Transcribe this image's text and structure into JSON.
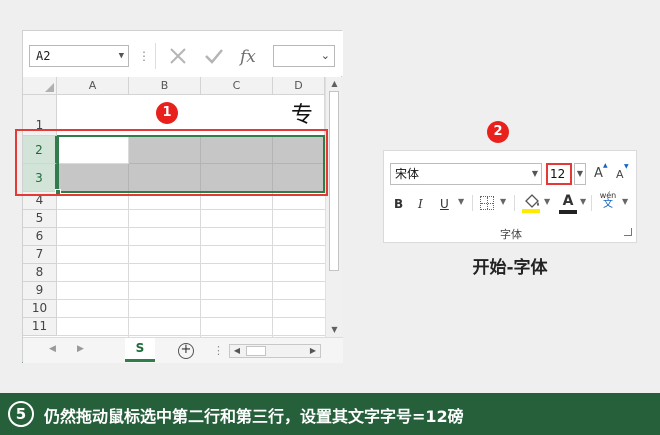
{
  "excel": {
    "namebox_value": "A2",
    "columns": [
      "A",
      "B",
      "C",
      "D"
    ],
    "rows": [
      "1",
      "2",
      "3",
      "4",
      "5",
      "6",
      "7",
      "8",
      "9",
      "10",
      "11"
    ],
    "title_partial_char": "专",
    "sheet_tab_label": "S",
    "add_sheet_symbol": "+"
  },
  "annotations": {
    "badge_1": "1",
    "badge_2": "2",
    "accent_color": "#e53935"
  },
  "font_panel": {
    "font_name": "宋体",
    "font_size": "12",
    "bold_label": "B",
    "italic_label": "I",
    "underline_label": "U",
    "grow_font_label": "A",
    "shrink_font_label": "A",
    "font_color_label": "A",
    "phonetic_upper": "wén",
    "phonetic_lower": "文",
    "group_label": "字体",
    "fill_color": "#ffeb00"
  },
  "panel_caption": "开始-字体",
  "instruction": {
    "step": "5",
    "text": "仍然拖动鼠标选中第二行和第三行，设置其文字字号=12磅",
    "bar_color": "#25603a"
  }
}
